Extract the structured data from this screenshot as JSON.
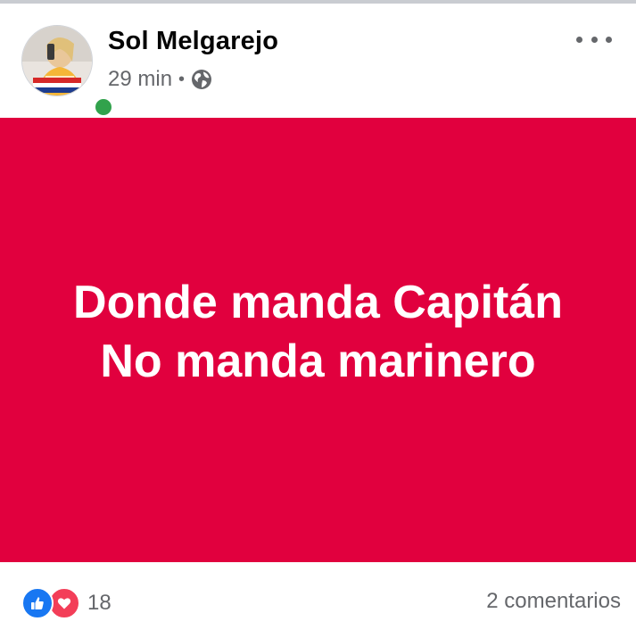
{
  "post": {
    "author": "Sol Melgarejo",
    "time": "29 min",
    "separator": "•",
    "audience_icon": "globe-icon",
    "more_icon": "more-horizontal-icon",
    "text_line_1": "Donde manda Capitán",
    "text_line_2": "No manda marinero",
    "background_color": "#e1003e",
    "text_color": "#ffffff"
  },
  "reactions": {
    "icons": [
      "like-icon",
      "love-icon"
    ],
    "count": "18"
  },
  "comments": {
    "label": "2 comentarios"
  },
  "status": {
    "online": true,
    "online_color": "#31a24c"
  }
}
